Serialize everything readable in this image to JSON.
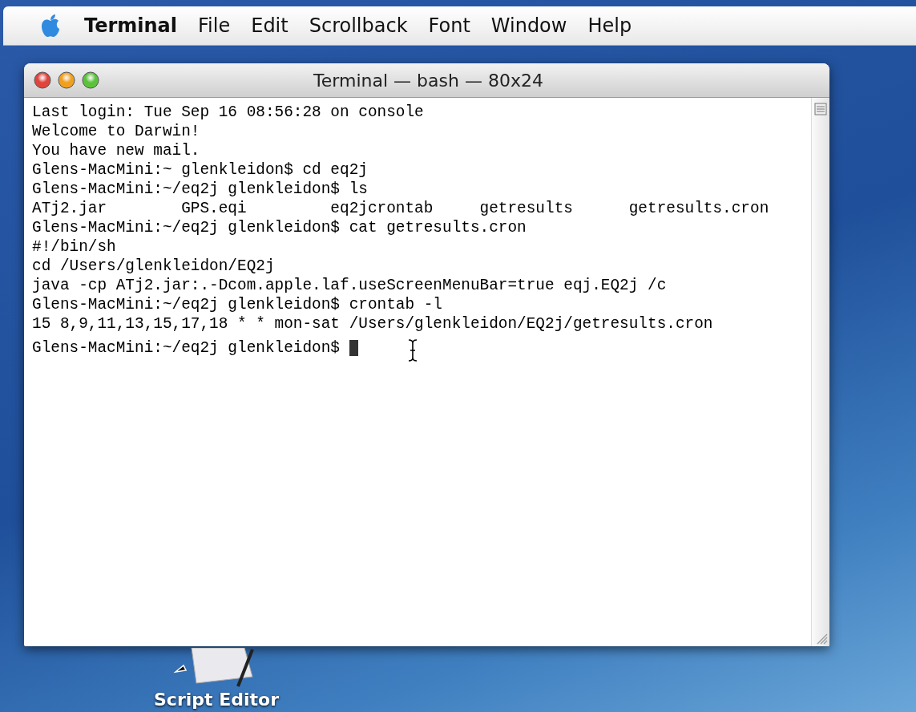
{
  "menu_bar": {
    "items": [
      {
        "label": "Terminal",
        "kind": "app"
      },
      {
        "label": "File",
        "kind": "menu"
      },
      {
        "label": "Edit",
        "kind": "menu"
      },
      {
        "label": "Scrollback",
        "kind": "menu"
      },
      {
        "label": "Font",
        "kind": "menu"
      },
      {
        "label": "Window",
        "kind": "menu"
      },
      {
        "label": "Help",
        "kind": "menu"
      }
    ]
  },
  "window": {
    "title": "Terminal — bash — 80x24",
    "lines": [
      "Last login: Tue Sep 16 08:56:28 on console",
      "Welcome to Darwin!",
      "You have new mail.",
      "Glens-MacMini:~ glenkleidon$ cd eq2j",
      "Glens-MacMini:~/eq2j glenkleidon$ ls",
      "ATj2.jar        GPS.eqi         eq2jcrontab     getresults      getresults.cron",
      "Glens-MacMini:~/eq2j glenkleidon$ cat getresults.cron",
      "#!/bin/sh",
      "cd /Users/glenkleidon/EQ2j",
      "java -cp ATj2.jar:.-Dcom.apple.laf.useScreenMenuBar=true eqj.EQ2j /c",
      "Glens-MacMini:~/eq2j glenkleidon$ crontab -l",
      "15 8,9,11,13,15,17,18 * * mon-sat /Users/glenkleidon/EQ2j/getresults.cron"
    ],
    "prompt": {
      "text": "Glens-MacMini:~/eq2j glenkleidon$ ",
      "cursor_shown": true
    }
  },
  "desktop_icons": [
    {
      "label": "Script Editor"
    }
  ]
}
